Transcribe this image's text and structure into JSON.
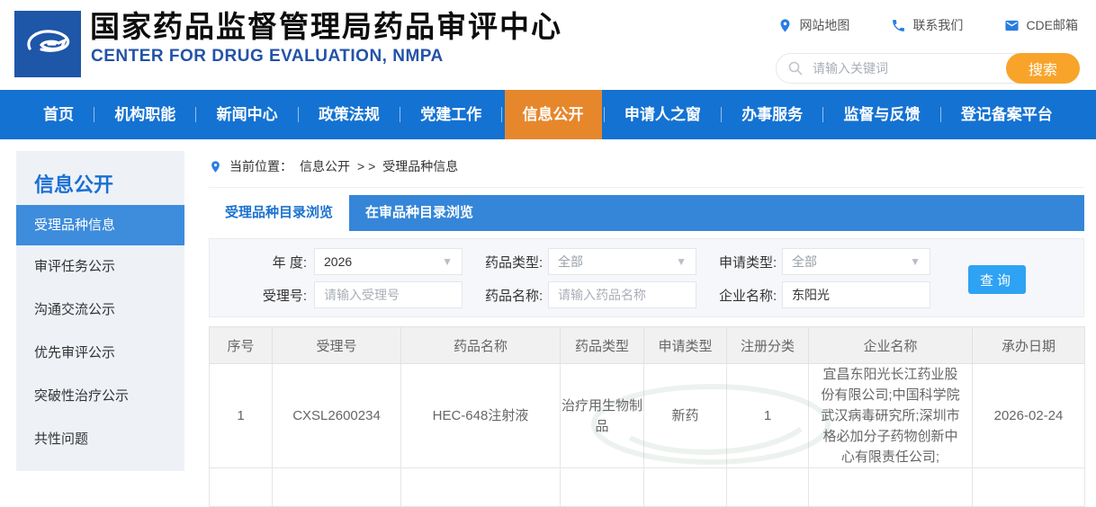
{
  "header": {
    "title": "国家药品监督管理局药品审评中心",
    "subtitle": "CENTER FOR DRUG EVALUATION, NMPA",
    "logo": "cde-swoosh-logo",
    "quick_links": [
      {
        "icon": "location-pin-icon",
        "label": "网站地图"
      },
      {
        "icon": "phone-icon",
        "label": "联系我们"
      },
      {
        "icon": "envelope-icon",
        "label": "CDE邮箱"
      }
    ],
    "search": {
      "icon": "search-icon",
      "placeholder": "请输入关键词",
      "button_label": "搜索"
    }
  },
  "nav": {
    "items": [
      {
        "label": "首页",
        "active": false
      },
      {
        "label": "机构职能",
        "active": false
      },
      {
        "label": "新闻中心",
        "active": false
      },
      {
        "label": "政策法规",
        "active": false
      },
      {
        "label": "党建工作",
        "active": false
      },
      {
        "label": "信息公开",
        "active": true
      },
      {
        "label": "申请人之窗",
        "active": false
      },
      {
        "label": "办事服务",
        "active": false
      },
      {
        "label": "监督与反馈",
        "active": false
      },
      {
        "label": "登记备案平台",
        "active": false
      }
    ]
  },
  "sidebar": {
    "title": "信息公开",
    "items": [
      {
        "label": "受理品种信息",
        "active": true
      },
      {
        "label": "审评任务公示",
        "active": false
      },
      {
        "label": "沟通交流公示",
        "active": false
      },
      {
        "label": "优先审评公示",
        "active": false
      },
      {
        "label": "突破性治疗公示",
        "active": false
      },
      {
        "label": "共性问题",
        "active": false
      }
    ]
  },
  "main": {
    "breadcrumb": {
      "icon": "location-pin-icon",
      "prefix": "当前位置：",
      "section": "信息公开",
      "separator": ">  >",
      "current": "受理品种信息"
    },
    "tabs": [
      {
        "label": "受理品种目录浏览",
        "active": true
      },
      {
        "label": "在审品种目录浏览",
        "active": false
      }
    ],
    "filters": {
      "year": {
        "label": "年 度:",
        "value": "2026"
      },
      "drug_type": {
        "label": "药品类型:",
        "value": "全部"
      },
      "apply_type": {
        "label": "申请类型:",
        "value": "全部"
      },
      "acceptance_no": {
        "label": "受理号:",
        "placeholder": "请输入受理号",
        "value": ""
      },
      "drug_name": {
        "label": "药品名称:",
        "placeholder": "请输入药品名称",
        "value": ""
      },
      "company_name": {
        "label": "企业名称:",
        "value": "东阳光"
      },
      "query_button_label": "查询"
    },
    "table": {
      "columns": [
        "序号",
        "受理号",
        "药品名称",
        "药品类型",
        "申请类型",
        "注册分类",
        "企业名称",
        "承办日期"
      ],
      "rows": [
        [
          "1",
          "CXSL2600234",
          "HEC-648注射液",
          "治疗用生物制品",
          "新药",
          "1",
          "宜昌东阳光长江药业股份有限公司;中国科学院武汉病毒研究所;深圳市格必加分子药物创新中心有限责任公司;",
          "2026-02-24"
        ]
      ]
    }
  },
  "colors": {
    "nav_blue": "#1472D2",
    "nav_active": "#E6872C",
    "tab_bar": "#3586D8",
    "tab_active_text": "#1B72CF",
    "sidebar_bg": "#EEF2F7",
    "sidebar_title": "#1B6FD3",
    "sidebar_active": "#3E8CDC",
    "search_button": "#F8A42A",
    "query_button": "#2EA2F3",
    "subtitle": "#2353A8",
    "icon_blue": "#2A7DE1",
    "table_header_bg": "#F1F1F1"
  }
}
